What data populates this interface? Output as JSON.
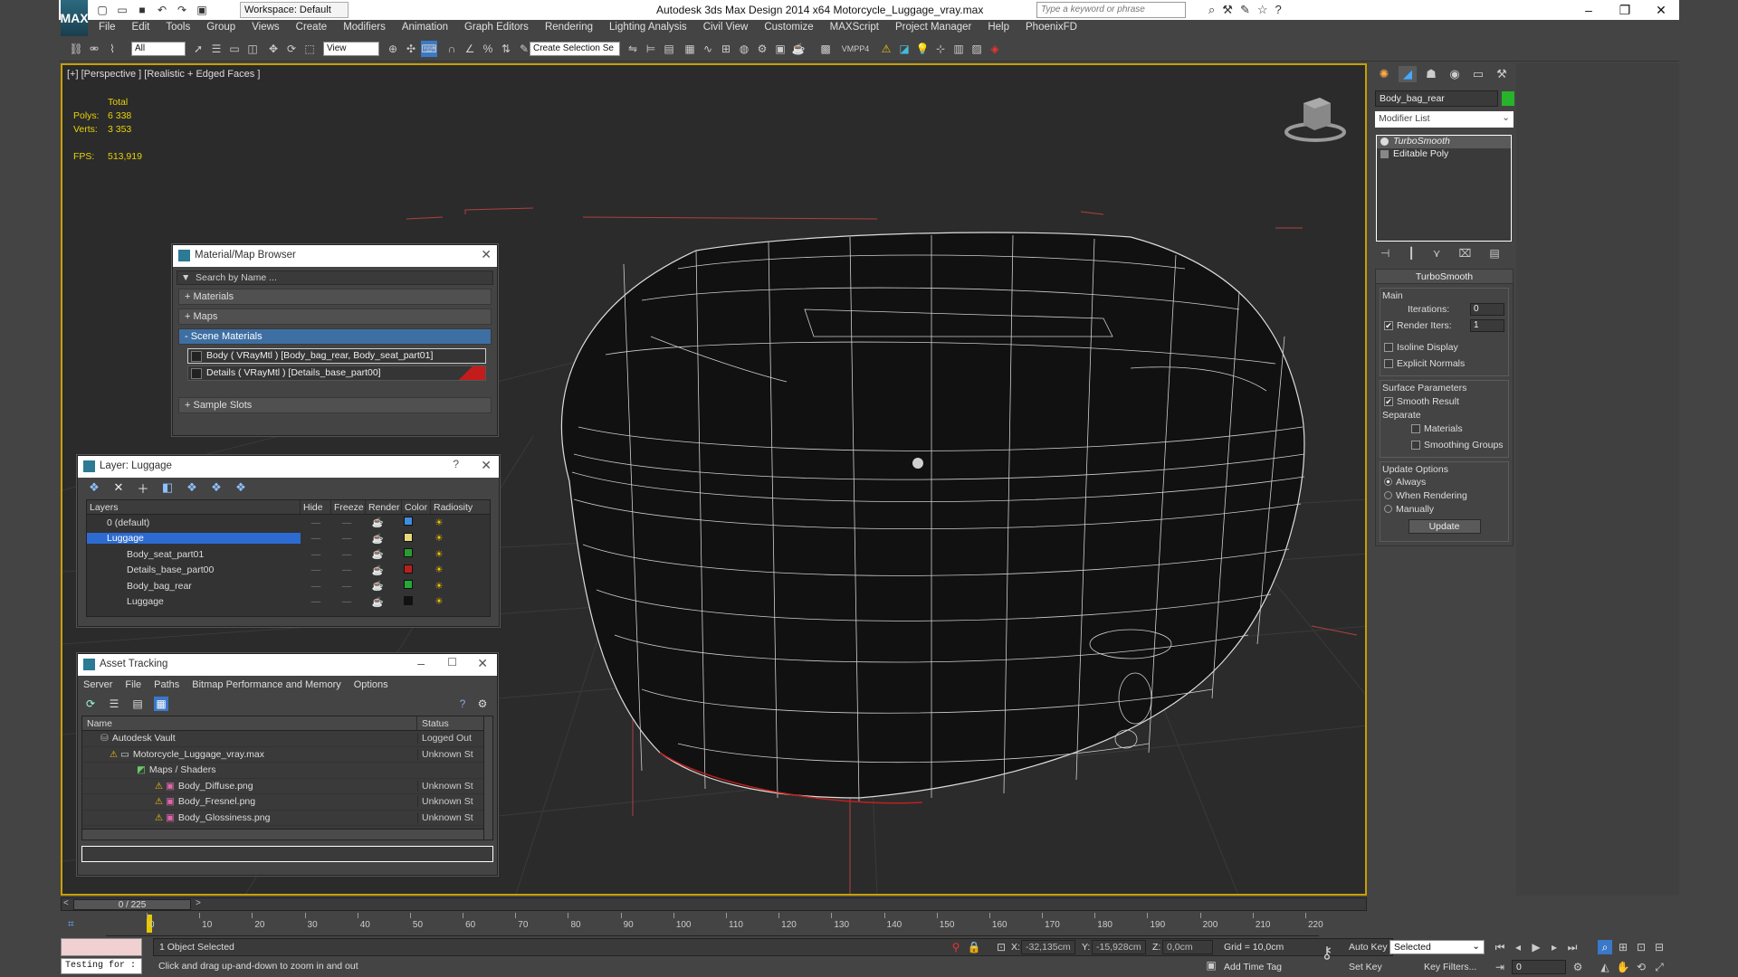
{
  "app": {
    "window_title": "Autodesk 3ds Max Design 2014 x64     Motorcycle_Luggage_vray.max",
    "workspace": "Workspace: Default",
    "search_placeholder": "Type a keyword or phrase",
    "logo_text": "MAX"
  },
  "menu": [
    "File",
    "Edit",
    "Tools",
    "Group",
    "Views",
    "Create",
    "Modifiers",
    "Animation",
    "Graph Editors",
    "Rendering",
    "Lighting Analysis",
    "Civil View",
    "Customize",
    "MAXScript",
    "Project Manager",
    "Help",
    "PhoenixFD"
  ],
  "toolbar": {
    "selection_filter": "All",
    "ref_coord": "View",
    "named_selection": "Create Selection Se",
    "vmpp": "VMPP4"
  },
  "viewport": {
    "label": "[+] [Perspective ] [Realistic + Edged Faces ]",
    "stats_header": "Total",
    "polys_label": "Polys:",
    "polys_value": "6 338",
    "verts_label": "Verts:",
    "verts_value": "3 353",
    "fps_label": "FPS:",
    "fps_value": "513,919"
  },
  "material_browser": {
    "title": "Material/Map Browser",
    "search_placeholder": "Search by Name ...",
    "categories": [
      "+ Materials",
      "+ Maps",
      "- Scene Materials"
    ],
    "items": [
      "Body ( VRayMtl ) [Body_bag_rear, Body_seat_part01]",
      "Details ( VRayMtl ) [Details_base_part00]"
    ],
    "sample_slots": "+ Sample Slots"
  },
  "layer_panel": {
    "title": "Layer: Luggage",
    "help": "?",
    "columns": [
      "Layers",
      "Hide",
      "Freeze",
      "Render",
      "Color",
      "Radiosity"
    ],
    "rows": [
      {
        "name": "0 (default)",
        "color": "#3f8de0"
      },
      {
        "name": "Luggage",
        "color": "#e7d97a"
      },
      {
        "name": "Body_seat_part01",
        "color": "#2a9a32"
      },
      {
        "name": "Details_base_part00",
        "color": "#b8201c"
      },
      {
        "name": "Body_bag_rear",
        "color": "#25a83a"
      },
      {
        "name": "Luggage",
        "color": "#111111"
      }
    ]
  },
  "asset_tracking": {
    "title": "Asset Tracking",
    "menu": [
      "Server",
      "File",
      "Paths",
      "Bitmap Performance and Memory",
      "Options"
    ],
    "columns": [
      "Name",
      "Status"
    ],
    "rows": [
      {
        "name": "Autodesk Vault",
        "status": "Logged Out"
      },
      {
        "name": "Motorcycle_Luggage_vray.max",
        "status": "Unknown St"
      },
      {
        "name": "Maps / Shaders",
        "status": ""
      },
      {
        "name": "Body_Diffuse.png",
        "status": "Unknown St"
      },
      {
        "name": "Body_Fresnel.png",
        "status": "Unknown St"
      },
      {
        "name": "Body_Glossiness.png",
        "status": "Unknown St"
      }
    ]
  },
  "command_panel": {
    "object_name": "Body_bag_rear",
    "modifier_list": "Modifier List",
    "stack": [
      "TurboSmooth",
      "Editable Poly"
    ],
    "rollout_title": "TurboSmooth",
    "main_group": "Main",
    "iterations_label": "Iterations:",
    "iterations_value": "0",
    "render_iters_label": "Render Iters:",
    "render_iters_value": "1",
    "isoline": "Isoline Display",
    "explicit_normals": "Explicit Normals",
    "surface_group": "Surface Parameters",
    "smooth_result": "Smooth Result",
    "separate": "Separate",
    "materials": "Materials",
    "smoothing_groups": "Smoothing Groups",
    "update_group": "Update Options",
    "always": "Always",
    "when_rendering": "When Rendering",
    "manually": "Manually",
    "update_btn": "Update"
  },
  "timeline": {
    "frame": "0 / 225",
    "ticks": [
      "0",
      "10",
      "20",
      "30",
      "40",
      "50",
      "60",
      "70",
      "80",
      "90",
      "100",
      "110",
      "120",
      "130",
      "140",
      "150",
      "160",
      "170",
      "180",
      "190",
      "200",
      "210",
      "220"
    ]
  },
  "status": {
    "script": "Testing for :",
    "selected": "1 Object Selected",
    "prompt": "Click and drag up-and-down to zoom in and out",
    "x_label": "X:",
    "x_value": "-32,135cm",
    "y_label": "Y:",
    "y_value": "-15,928cm",
    "z_label": "Z:",
    "z_value": "0,0cm",
    "grid": "Grid = 10,0cm",
    "add_time_tag": "Add Time Tag",
    "auto_key": "Auto Key",
    "set_key": "Set Key",
    "selected_combo": "Selected",
    "key_filters": "Key Filters...",
    "frame_value": "0"
  }
}
